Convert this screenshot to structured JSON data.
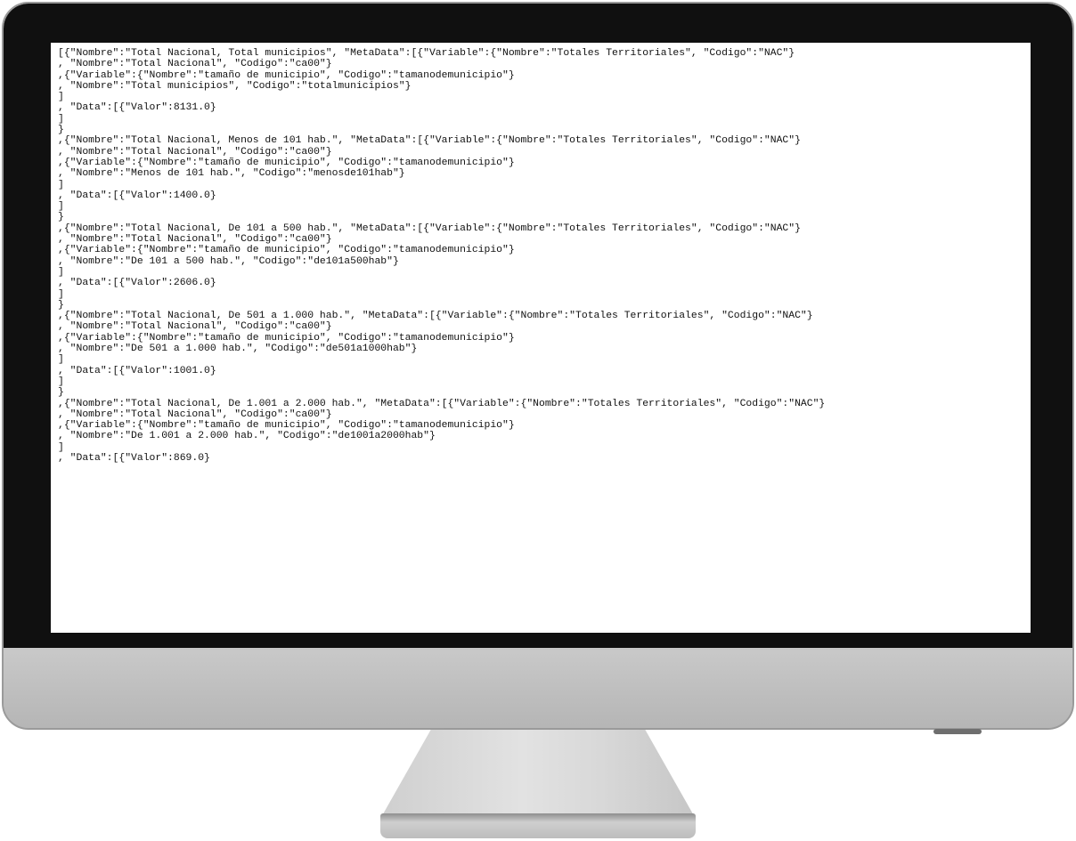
{
  "screen": {
    "lines": [
      "[{\"Nombre\":\"Total Nacional, Total municipios\", \"MetaData\":[{\"Variable\":{\"Nombre\":\"Totales Territoriales\", \"Codigo\":\"NAC\"}",
      ", \"Nombre\":\"Total Nacional\", \"Codigo\":\"ca00\"}",
      ",{\"Variable\":{\"Nombre\":\"tamaño de municipio\", \"Codigo\":\"tamanodemunicipio\"}",
      ", \"Nombre\":\"Total municipios\", \"Codigo\":\"totalmunicipios\"}",
      "]",
      ", \"Data\":[{\"Valor\":8131.0}",
      "]",
      "}",
      ",{\"Nombre\":\"Total Nacional, Menos de 101 hab.\", \"MetaData\":[{\"Variable\":{\"Nombre\":\"Totales Territoriales\", \"Codigo\":\"NAC\"}",
      ", \"Nombre\":\"Total Nacional\", \"Codigo\":\"ca00\"}",
      ",{\"Variable\":{\"Nombre\":\"tamaño de municipio\", \"Codigo\":\"tamanodemunicipio\"}",
      ", \"Nombre\":\"Menos de 101 hab.\", \"Codigo\":\"menosde101hab\"}",
      "]",
      ", \"Data\":[{\"Valor\":1400.0}",
      "]",
      "}",
      ",{\"Nombre\":\"Total Nacional, De 101 a 500 hab.\", \"MetaData\":[{\"Variable\":{\"Nombre\":\"Totales Territoriales\", \"Codigo\":\"NAC\"}",
      ", \"Nombre\":\"Total Nacional\", \"Codigo\":\"ca00\"}",
      ",{\"Variable\":{\"Nombre\":\"tamaño de municipio\", \"Codigo\":\"tamanodemunicipio\"}",
      ", \"Nombre\":\"De 101 a 500 hab.\", \"Codigo\":\"de101a500hab\"}",
      "]",
      ", \"Data\":[{\"Valor\":2606.0}",
      "]",
      "}",
      ",{\"Nombre\":\"Total Nacional, De 501 a 1.000 hab.\", \"MetaData\":[{\"Variable\":{\"Nombre\":\"Totales Territoriales\", \"Codigo\":\"NAC\"}",
      ", \"Nombre\":\"Total Nacional\", \"Codigo\":\"ca00\"}",
      ",{\"Variable\":{\"Nombre\":\"tamaño de municipio\", \"Codigo\":\"tamanodemunicipio\"}",
      ", \"Nombre\":\"De 501 a 1.000 hab.\", \"Codigo\":\"de501a1000hab\"}",
      "]",
      ", \"Data\":[{\"Valor\":1001.0}",
      "]",
      "}",
      ",{\"Nombre\":\"Total Nacional, De 1.001 a 2.000 hab.\", \"MetaData\":[{\"Variable\":{\"Nombre\":\"Totales Territoriales\", \"Codigo\":\"NAC\"}",
      ", \"Nombre\":\"Total Nacional\", \"Codigo\":\"ca00\"}",
      ",{\"Variable\":{\"Nombre\":\"tamaño de municipio\", \"Codigo\":\"tamanodemunicipio\"}",
      ", \"Nombre\":\"De 1.001 a 2.000 hab.\", \"Codigo\":\"de1001a2000hab\"}",
      "]",
      ", \"Data\":[{\"Valor\":869.0}",
      "]"
    ]
  }
}
